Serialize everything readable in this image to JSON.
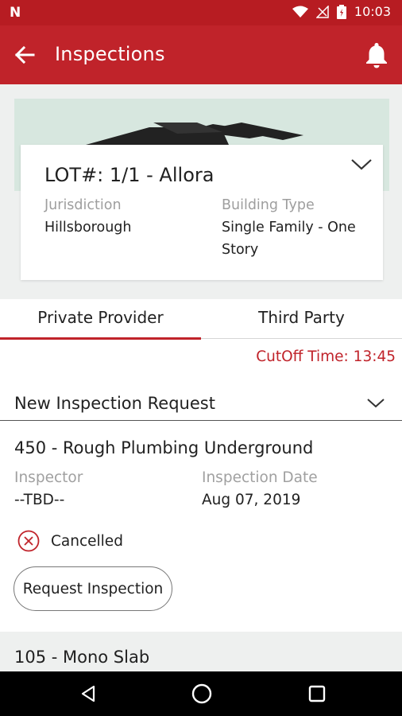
{
  "status_bar": {
    "carrier_icon": "n-logo-icon",
    "time": "10:03",
    "icons": [
      "wifi-icon",
      "no-signal-icon",
      "battery-icon"
    ]
  },
  "app_bar": {
    "title": "Inspections",
    "back_icon": "arrow-left-icon",
    "bell_icon": "bell-icon",
    "color": "#c0232a"
  },
  "lot": {
    "title": "LOT#: 1/1 - Allora",
    "jurisdiction_label": "Jurisdiction",
    "jurisdiction_value": "Hillsborough",
    "building_type_label": "Building Type",
    "building_type_line1": "Single Family - One",
    "building_type_line2": "Story"
  },
  "tabs": [
    {
      "label": "Private Provider",
      "active": true
    },
    {
      "label": "Third Party",
      "active": false
    }
  ],
  "cutoff_time": "CutOff Time: 13:45",
  "section": {
    "title": "New Inspection Request"
  },
  "inspection": {
    "name": "450 - Rough Plumbing Underground",
    "inspector_label": "Inspector",
    "inspector_value": "--TBD--",
    "date_label": "Inspection Date",
    "date_value": "Aug 07, 2019",
    "status": "Cancelled",
    "button_label": "Request Inspection"
  },
  "next_inspection": {
    "name": "105 - Mono Slab"
  },
  "nav_bar": {
    "icons": [
      "back-triangle-icon",
      "home-circle-icon",
      "recents-square-icon"
    ]
  }
}
